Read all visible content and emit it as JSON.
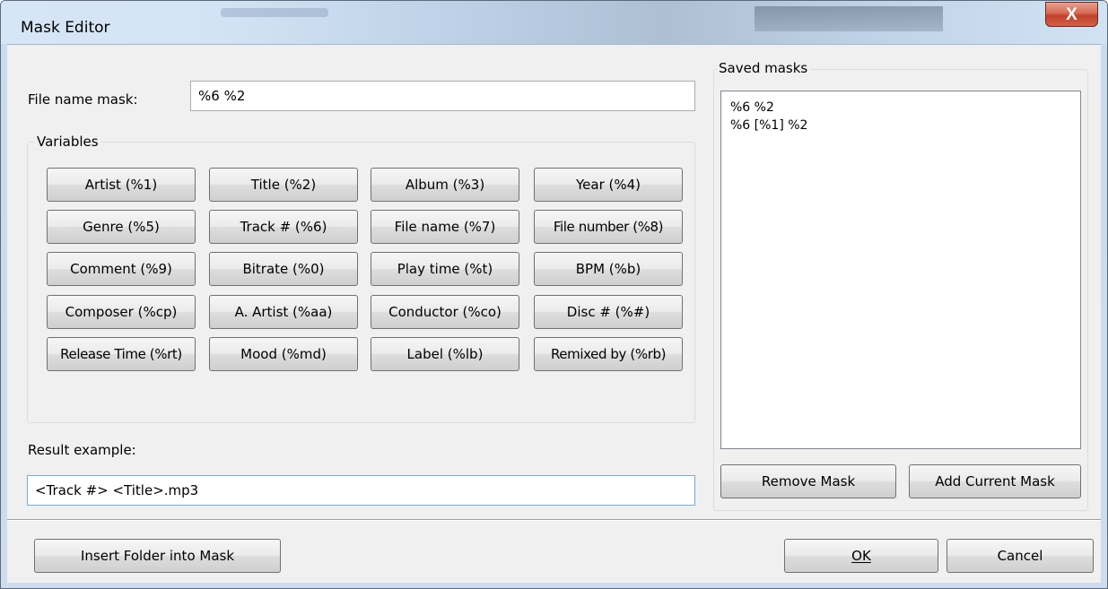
{
  "window": {
    "title": "Mask Editor",
    "close_glyph": "X",
    "close_icon": "close-icon"
  },
  "mask": {
    "label": "File name mask:",
    "value": "%6 %2"
  },
  "variables": {
    "legend": "Variables",
    "buttons": [
      "Artist (%1)",
      "Title (%2)",
      "Album (%3)",
      "Year (%4)",
      "Genre (%5)",
      "Track # (%6)",
      "File name (%7)",
      "File number (%8)",
      "Comment (%9)",
      "Bitrate (%0)",
      "Play time (%t)",
      "BPM (%b)",
      "Composer (%cp)",
      "A. Artist (%aa)",
      "Conductor (%co)",
      "Disc # (%#)",
      "Release Time (%rt)",
      "Mood (%md)",
      "Label (%lb)",
      "Remixed by (%rb)"
    ]
  },
  "result": {
    "label": "Result example:",
    "value": "<Track #> <Title>.mp3"
  },
  "saved_masks": {
    "legend": "Saved masks",
    "items": [
      "%6 %2",
      "%6 [%1] %2"
    ],
    "remove_label": "Remove Mask",
    "add_label": "Add Current Mask"
  },
  "footer": {
    "insert_folder_label": "Insert Folder into Mask",
    "ok_label": "OK",
    "cancel_label": "Cancel"
  },
  "colors": {
    "dialog_background": "#f0f0f0",
    "close_button": "#c7402d",
    "titlebar": "#d3e3f5"
  }
}
